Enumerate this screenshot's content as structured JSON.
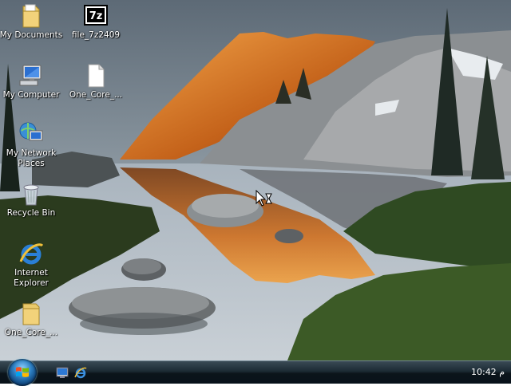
{
  "desktop_icons": [
    {
      "label": "My Documents",
      "icon": "folder-documents-icon"
    },
    {
      "label": "file_7z2409",
      "icon": "7zip-icon"
    },
    {
      "label": "My Computer",
      "icon": "computer-icon"
    },
    {
      "label": "One_Core_...",
      "icon": "blank-file-icon"
    },
    {
      "label": "My Network Places",
      "icon": "network-icon"
    },
    {
      "label": "Recycle Bin",
      "icon": "recycle-bin-icon"
    },
    {
      "label": "Internet Explorer",
      "icon": "ie-icon"
    },
    {
      "label": "One_Core_...",
      "icon": "folder-icon"
    }
  ],
  "seven_zip_mark": "7z",
  "taskbar": {
    "quick_launch": [
      "show-desktop-icon",
      "ie-icon"
    ],
    "clock": "10:42 م"
  },
  "colors": {
    "taskbar": "#0b141a",
    "start_orb": "#2d7fc2",
    "sky": "#7d8e9c",
    "sunlit_rock": "#e07a1e"
  }
}
